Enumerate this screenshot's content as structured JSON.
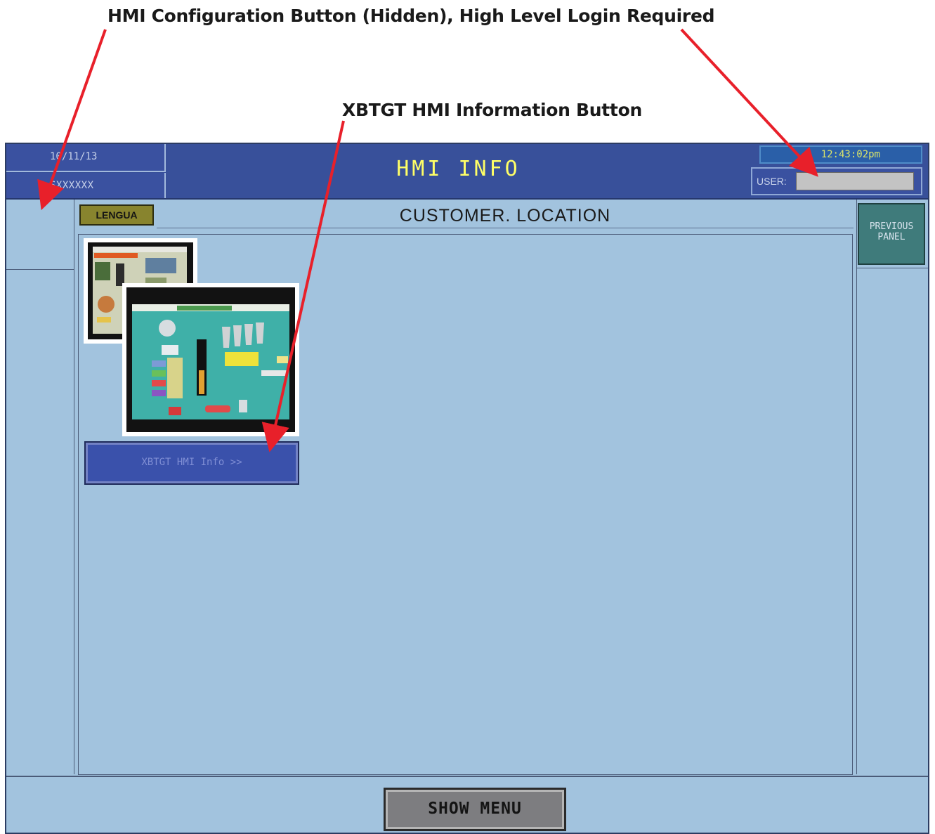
{
  "callouts": {
    "config": "HMI Configuration Button (Hidden), High Level Login Required",
    "info": "XBTGT HMI Information Button"
  },
  "header": {
    "date": "10/11/13",
    "id": "SXXXXXX",
    "title": "HMI INFO",
    "clock": "12:43:02pm",
    "user_label": "USER:",
    "user_value": ""
  },
  "main": {
    "language_button": "LENGUA",
    "location": "CUSTOMER. LOCATION",
    "info_button": "XBTGT HMI Info >>"
  },
  "sidebar_right": {
    "previous_panel": "PREVIOUS PANEL"
  },
  "footer": {
    "show_menu": "SHOW MENU"
  },
  "colors": {
    "title_bar": "#38509a",
    "background": "#a2c3de",
    "title_text": "#ffff66",
    "lengua_button": "#88842e",
    "previous_button": "#3f7b7b",
    "show_menu_button": "#7d7d80",
    "arrow": "#e8202a"
  }
}
